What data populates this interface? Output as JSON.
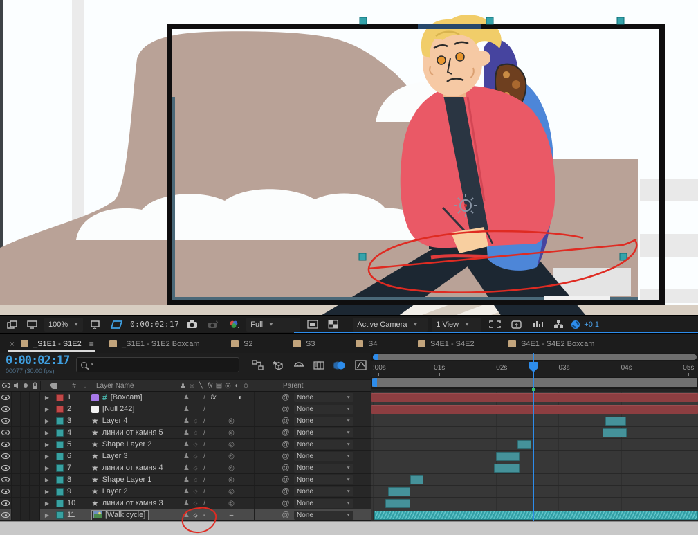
{
  "comp_toolbar": {
    "zoom_value": "100%",
    "timecode": "0:00:02:17",
    "resolution_value": "Full",
    "camera_value": "Active Camera",
    "view_value": "1 View",
    "render_offset": "+0,1"
  },
  "tabs": [
    {
      "label": "_S1E1 - S1E2",
      "active": true
    },
    {
      "label": "_S1E1 - S1E2 Boxcam",
      "active": false
    },
    {
      "label": "S2",
      "active": false
    },
    {
      "label": "S3",
      "active": false
    },
    {
      "label": "S4",
      "active": false
    },
    {
      "label": "S4E1 - S4E2",
      "active": false
    },
    {
      "label": "S4E1 - S4E2 Boxcam",
      "active": false
    }
  ],
  "timeline": {
    "timecode": "0:00:02:17",
    "frame_info": "00077 (30.00 fps)",
    "search_placeholder": "",
    "toolbar_icons": [
      "comp-mini-flowchart-icon",
      "draft-3d-icon",
      "shy-master-icon",
      "frame-blend-master-icon",
      "motion-blur-master-icon",
      "graph-editor-icon"
    ],
    "header": {
      "layer_name": "Layer Name",
      "hash": "#",
      "dot": ".",
      "parent": "Parent"
    },
    "ruler_ticks": [
      {
        "label": ":00s",
        "pct": 0.4
      },
      {
        "label": "01s",
        "pct": 19.1
      },
      {
        "label": "02s",
        "pct": 38.2
      },
      {
        "label": "03s",
        "pct": 57.3
      },
      {
        "label": "04s",
        "pct": 76.4
      },
      {
        "label": "05s",
        "pct": 95.4
      }
    ],
    "playhead_pct": 49.4,
    "bar_colors": {
      "maroon": "#8d3e41",
      "teal": "#45929a",
      "selected": "#39b3b9"
    },
    "label_colors": {
      "red": "#c24848",
      "teal": "#38a1a1",
      "purple": "#a678e8",
      "white": "#f2f2f2"
    },
    "parent_default": "None",
    "layers": [
      {
        "index": 1,
        "name": "[Boxcam]",
        "label_color": "red",
        "type": "comp-hash",
        "switches": {
          "shy": true,
          "quality": "/",
          "fx": true,
          "adjustment": true
        },
        "parent": "None",
        "bar": {
          "start": 0,
          "end": 100,
          "kind": "maroon"
        }
      },
      {
        "index": 2,
        "name": "[Null 242]",
        "label_color": "red",
        "type": "null",
        "switches": {
          "shy": true,
          "quality": "/"
        },
        "parent": "None",
        "bar": {
          "start": 0,
          "end": 100,
          "kind": "maroon"
        }
      },
      {
        "index": 3,
        "name": "Layer 4",
        "label_color": "teal",
        "type": "shape",
        "switches": {
          "shy": true,
          "collapse": "dim",
          "quality": "/",
          "motion_blur": true
        },
        "parent": "None",
        "bar": {
          "start": 71.6,
          "end": 78.0,
          "kind": "teal"
        }
      },
      {
        "index": 4,
        "name": "линии от камня 5",
        "label_color": "teal",
        "type": "shape",
        "switches": {
          "shy": true,
          "collapse": "dim",
          "quality": "/",
          "motion_blur": true
        },
        "parent": "None",
        "bar": {
          "start": 70.8,
          "end": 78.2,
          "kind": "teal"
        }
      },
      {
        "index": 5,
        "name": "Shape Layer 2",
        "label_color": "teal",
        "type": "shape",
        "switches": {
          "shy": true,
          "collapse": "dim",
          "quality": "/",
          "motion_blur": true
        },
        "parent": "None",
        "bar": {
          "start": 44.7,
          "end": 48.9,
          "kind": "teal"
        }
      },
      {
        "index": 6,
        "name": "Layer 3",
        "label_color": "teal",
        "type": "shape",
        "switches": {
          "shy": true,
          "collapse": "dim",
          "quality": "/",
          "motion_blur": true
        },
        "parent": "None",
        "bar": {
          "start": 38.1,
          "end": 45.3,
          "kind": "teal"
        }
      },
      {
        "index": 7,
        "name": "линии от камня 4",
        "label_color": "teal",
        "type": "shape",
        "switches": {
          "shy": true,
          "collapse": "dim",
          "quality": "/",
          "motion_blur": true
        },
        "parent": "None",
        "bar": {
          "start": 37.5,
          "end": 45.3,
          "kind": "teal"
        }
      },
      {
        "index": 8,
        "name": "Shape Layer 1",
        "label_color": "teal",
        "type": "shape",
        "switches": {
          "shy": true,
          "collapse": "dim",
          "quality": "/",
          "motion_blur": true
        },
        "parent": "None",
        "bar": {
          "start": 11.9,
          "end": 15.9,
          "kind": "teal"
        }
      },
      {
        "index": 9,
        "name": "Layer 2",
        "label_color": "teal",
        "type": "shape",
        "switches": {
          "shy": true,
          "collapse": "dim",
          "quality": "/",
          "motion_blur": true
        },
        "parent": "None",
        "bar": {
          "start": 5.1,
          "end": 11.9,
          "kind": "teal"
        }
      },
      {
        "index": 10,
        "name": "линии от камня 3",
        "label_color": "teal",
        "type": "shape",
        "switches": {
          "shy": true,
          "collapse": "dim",
          "quality": "/",
          "motion_blur": true
        },
        "parent": "None",
        "bar": {
          "start": 4.2,
          "end": 11.9,
          "kind": "teal"
        }
      },
      {
        "index": 11,
        "name": "[Walk cycle]",
        "label_color": "teal",
        "type": "footage",
        "selected": true,
        "switches": {
          "shy": true,
          "collapse": "bright",
          "quality": "-",
          "motion_blur_dash": true
        },
        "parent": "None",
        "bar": {
          "start": 0.8,
          "end": 100,
          "kind": "selected"
        }
      }
    ]
  },
  "annotations": {
    "color": "#df2b22"
  }
}
